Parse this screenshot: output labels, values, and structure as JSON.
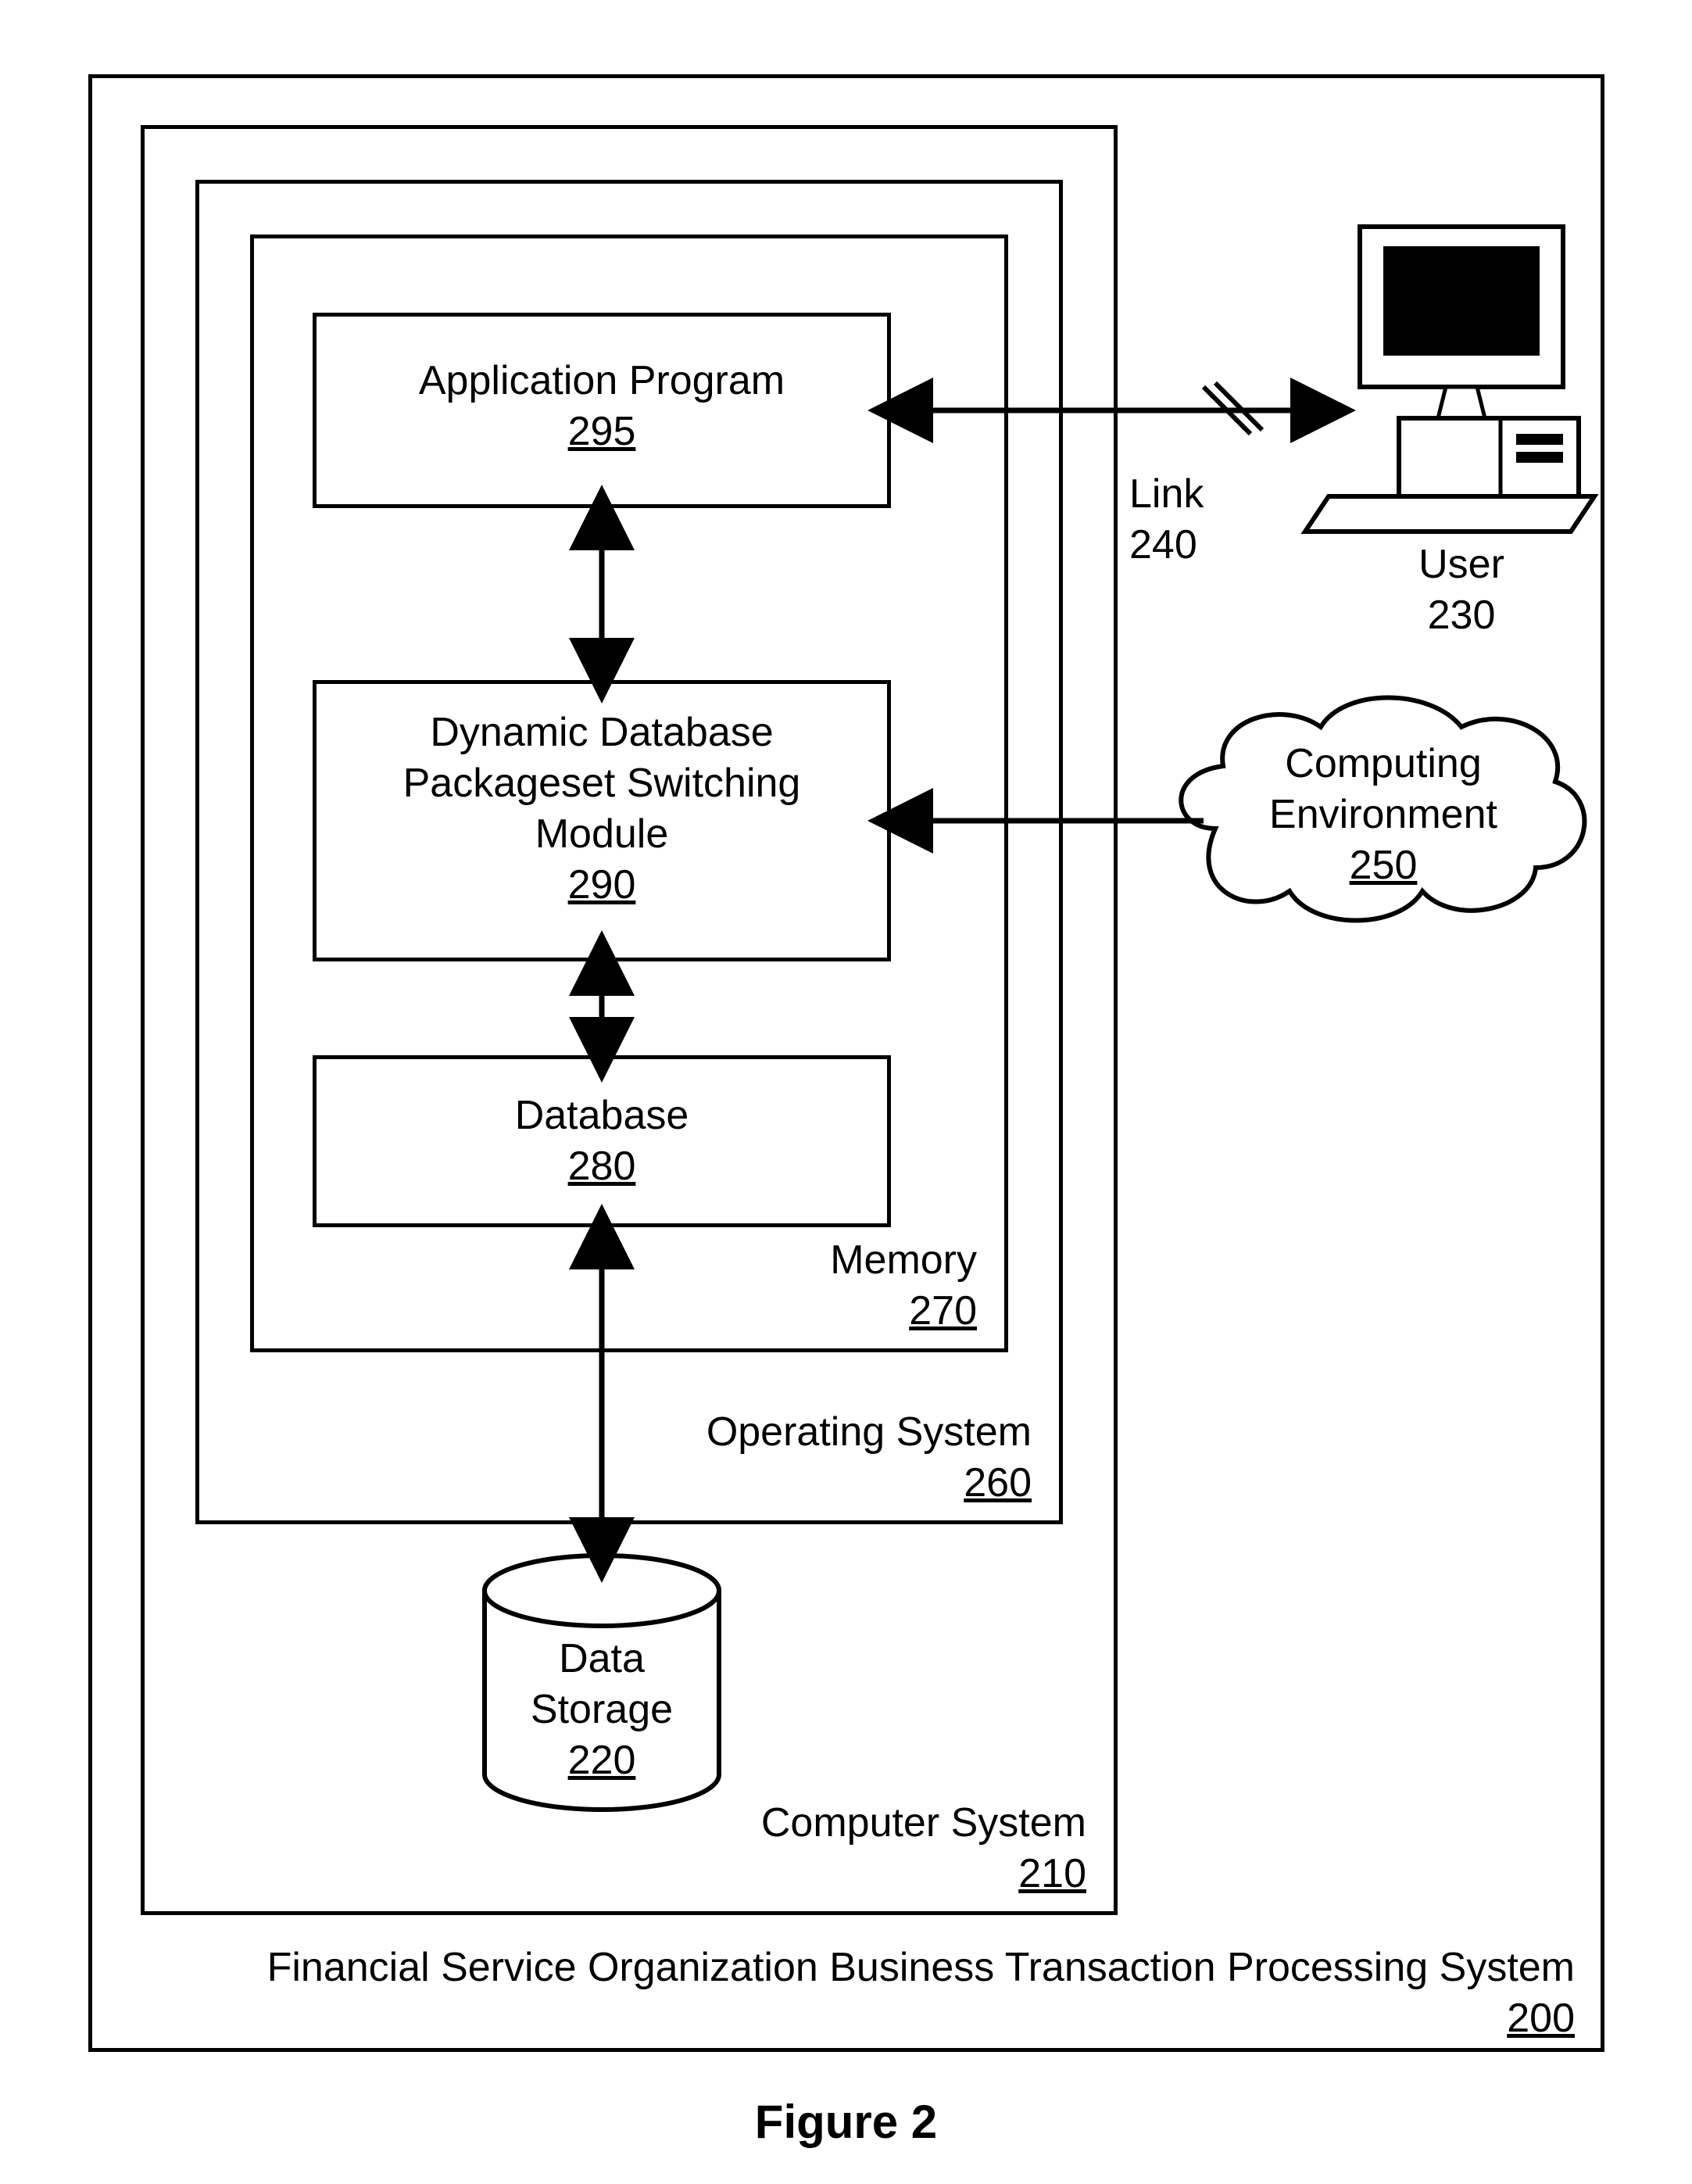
{
  "outer": {
    "label": "Financial Service Organization Business Transaction Processing System",
    "ref": "200"
  },
  "computer_system": {
    "label": "Computer System",
    "ref": "210"
  },
  "operating_system": {
    "label": "Operating System",
    "ref": "260"
  },
  "memory": {
    "label": "Memory",
    "ref": "270"
  },
  "app_program": {
    "label": "Application Program",
    "ref": "295"
  },
  "dbps_module": {
    "line1": "Dynamic Database",
    "line2": "Packageset Switching",
    "line3": "Module",
    "ref": "290"
  },
  "database": {
    "label": "Database",
    "ref": "280"
  },
  "data_storage": {
    "label1": "Data",
    "label2": "Storage",
    "ref": "220"
  },
  "link": {
    "label": "Link",
    "ref": "240"
  },
  "user": {
    "label": "User",
    "ref": "230"
  },
  "env": {
    "line1": "Computing",
    "line2": "Environment",
    "ref": "250"
  },
  "figure": "Figure 2"
}
